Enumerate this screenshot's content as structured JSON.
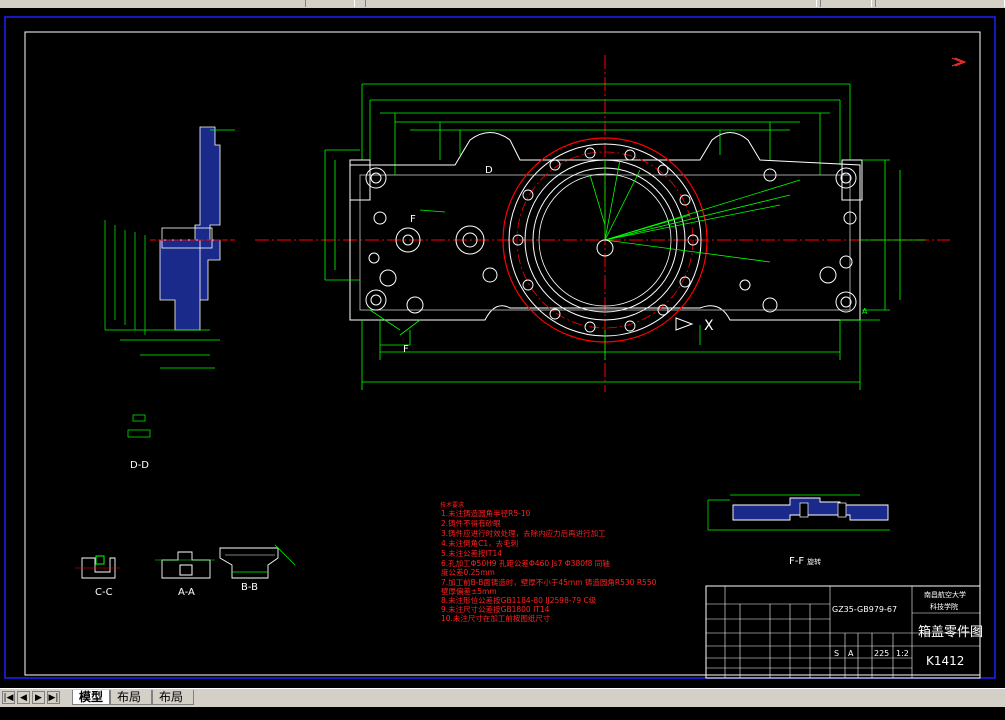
{
  "section_views": {
    "dd_label": "D-D",
    "cc_label": "C-C",
    "aa_label": "A-A",
    "bb_label": "B-B",
    "ff_label": "F-F",
    "ff_suffix": "旋转",
    "x_marker": "X",
    "f_marker": "F",
    "d_marker": "D",
    "a_marker": "A"
  },
  "tech_notes": {
    "title": "技术要求",
    "lines": [
      "1.未注铸造圆角半径R5-10",
      "2.铸件不得有砂眼",
      "3.铸件应进行时效处理，去除内应力后再进行加工",
      "4.未注倒角C1，去毛刺",
      "5.未注公差按IT14",
      "6.孔加工Φ50H9 孔距公差Φ460 Js7 Φ380f8 同轴",
      "  度公差0.25mm",
      "7.加工前B-B面铸造时，壁厚不小于45mm 铸造圆角R530 R550",
      "  壁厚偏差±5mm",
      "8.未注形位公差按GB1184-80 IJ2598-79 C级",
      "9.未注尺寸公差按GB1800 IT14",
      "10.未注尺寸在加工前按图纸尺寸"
    ]
  },
  "title_block": {
    "school": "南昌航空大学",
    "college": "科技学院",
    "drawing_no": "GZ35-GB979-67",
    "part_name": "箱盖零件图",
    "code": "K1412",
    "scale_row": [
      "S",
      "A",
      "225",
      "1:2"
    ]
  },
  "tabs": {
    "model": "模型",
    "layout1": "布局1",
    "layout2": "布局2"
  },
  "nav_buttons": [
    "|◀",
    "◀",
    "▶",
    "▶|"
  ],
  "colors": {
    "background": "#000000",
    "frame": "#2020ff",
    "geometry_green": "#00ff00",
    "red_lines": "#ff0000",
    "white_lines": "#ffffff",
    "section_fill": "#1a2a8a",
    "ui_gray": "#d4d0c8"
  }
}
